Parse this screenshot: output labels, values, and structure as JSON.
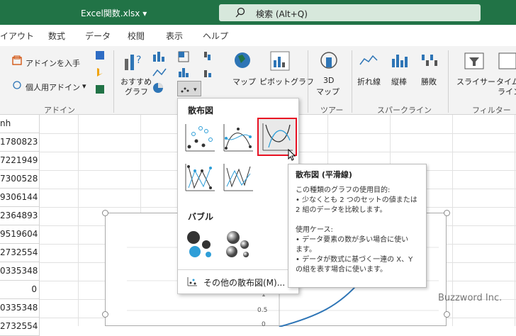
{
  "app": {
    "filename": "Excel関数.xlsx",
    "filename_caret": "▾",
    "search": "検索 (Alt+Q)"
  },
  "tabs": [
    "イアウト",
    "数式",
    "データ",
    "校閲",
    "表示",
    "ヘルプ"
  ],
  "ribbon": {
    "addin_get": "アドインを入手",
    "addin_personal": "個人用アドイン",
    "addin_group": "アドイン",
    "recommended": [
      "おすすめ",
      "グラフ"
    ],
    "maps": "マップ",
    "pivotchart": "ピボットグラフ",
    "map3d": [
      "3D",
      "マップ"
    ],
    "tour_group": "ツアー",
    "sparklines": [
      "折れ線",
      "縦棒",
      "勝敗"
    ],
    "spark_group": "スパークライン",
    "slicer": "スライサー",
    "timeline": [
      "タイム",
      "ライン"
    ],
    "filter_group": "フィルター"
  },
  "column_header": "nh",
  "cells": [
    "1780823",
    "7221949",
    "7300528",
    "9306144",
    "2364893",
    "9519604",
    "2732554",
    "0335348",
    "0",
    "0335348",
    "2732554"
  ],
  "scatter_menu": {
    "section1": "散布図",
    "section2": "バブル",
    "more": "その他の散布図(M)..."
  },
  "tooltip": {
    "title": "散布図 (平滑線)",
    "lines": [
      "この種類のグラフの使用目的:",
      "• 少なくとも 2 つのセットの値または",
      "2 組のデータを比較します。",
      "",
      "使用ケース:",
      "• データ要素の数が多い場合に使い",
      "ます。",
      "• データが数式に基づく一連の X、Y",
      "の組を表す場合に使います。"
    ]
  },
  "chart_axis": {
    "ticks": [
      "1",
      "0.5",
      "0"
    ]
  },
  "watermark": "Buzzword Inc.",
  "colors": {
    "excel_green": "#217346",
    "search_bg": "#d7e8dc",
    "selection": "#e81123",
    "series_blue": "#2e75b6"
  }
}
